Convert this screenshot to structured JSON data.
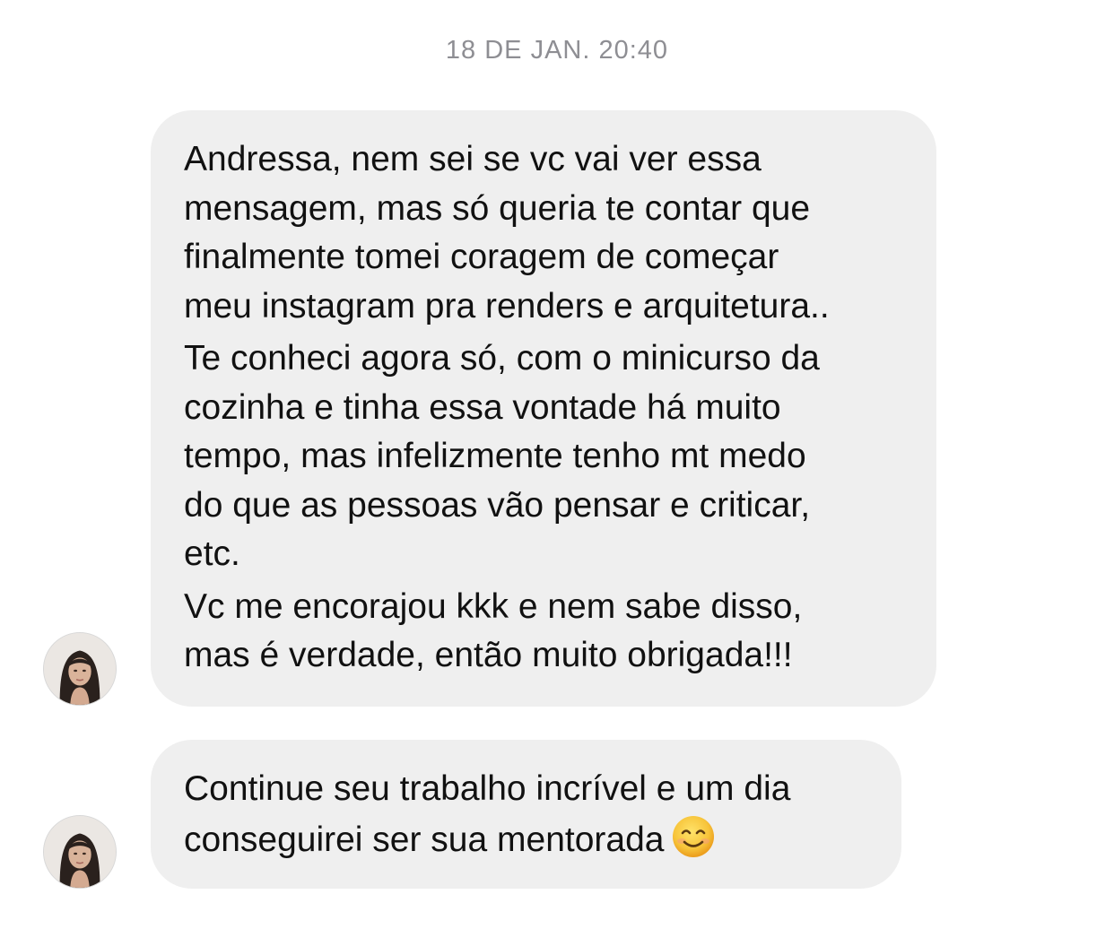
{
  "thread": {
    "timestamp": "18 DE JAN. 20:40"
  },
  "messages": [
    {
      "sender": "incoming",
      "avatar_icon": "user-avatar-photo",
      "paragraphs": [
        {
          "lines": [
            "Andressa, nem sei se vc vai ver essa",
            "mensagem, mas só queria te contar que",
            "finalmente tomei coragem de começar",
            "meu instagram pra renders e arquitetura.."
          ]
        },
        {
          "lines": [
            "Te conheci agora só, com o minicurso da",
            "cozinha e tinha essa vontade há muito",
            "tempo, mas infelizmente tenho mt medo",
            "do que as pessoas vão pensar e criticar,",
            "etc."
          ]
        },
        {
          "lines": [
            "Vc me encorajou kkk e nem sabe disso,",
            "mas é verdade, então muito obrigada!!!"
          ]
        }
      ]
    },
    {
      "sender": "incoming",
      "avatar_icon": "user-avatar-photo",
      "paragraphs": [
        {
          "lines": [
            "Continue seu trabalho incrível e um dia",
            "conseguirei ser sua mentorada"
          ],
          "trailing_emoji": "smiling-face-emoji"
        }
      ]
    }
  ],
  "colors": {
    "bubble_background": "#efefef",
    "timestamp_text": "#8e8e93",
    "message_text": "#111111",
    "emoji_face": "#f7c43a"
  }
}
